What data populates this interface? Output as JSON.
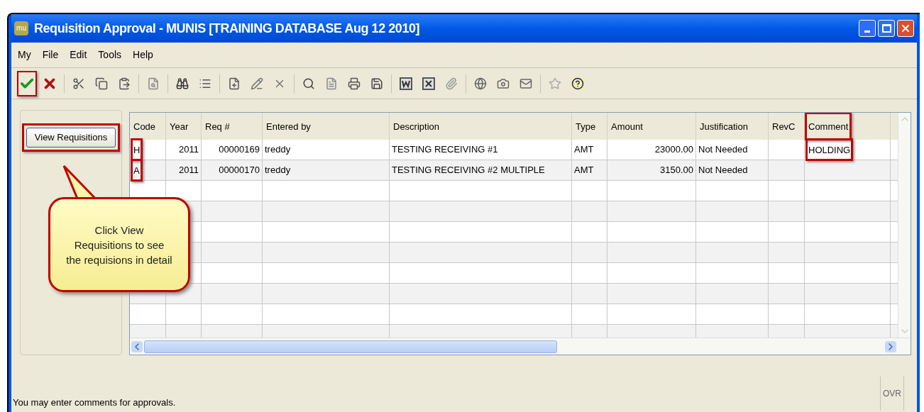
{
  "window": {
    "title": "Requisition Approval - MUNIS [TRAINING DATABASE Aug 12 2010]",
    "app_icon": "mu"
  },
  "menu": [
    "My",
    "File",
    "Edit",
    "Tools",
    "Help"
  ],
  "toolbar": [
    {
      "buttons": [
        {
          "kind": "approve",
          "highlighted": true
        },
        {
          "kind": "reject",
          "highlighted": false
        }
      ]
    },
    {
      "buttons": [
        {
          "kind": "cut",
          "highlighted": false
        },
        {
          "kind": "copy",
          "highlighted": false
        },
        {
          "kind": "paste",
          "highlighted": false
        }
      ]
    },
    {
      "buttons": [
        {
          "kind": "browse",
          "highlighted": false
        }
      ]
    },
    {
      "buttons": [
        {
          "kind": "find",
          "highlighted": false
        },
        {
          "kind": "list",
          "highlighted": false
        }
      ]
    },
    {
      "buttons": [
        {
          "kind": "add",
          "highlighted": false
        },
        {
          "kind": "edit",
          "highlighted": false
        },
        {
          "kind": "delete",
          "highlighted": false
        }
      ]
    },
    {
      "buttons": [
        {
          "kind": "preview",
          "highlighted": false
        },
        {
          "kind": "document",
          "highlighted": false
        },
        {
          "kind": "print",
          "highlighted": false
        },
        {
          "kind": "save",
          "highlighted": false
        }
      ]
    },
    {
      "buttons": [
        {
          "kind": "word",
          "highlighted": false
        },
        {
          "kind": "excel",
          "highlighted": false
        },
        {
          "kind": "attach",
          "highlighted": false
        }
      ]
    },
    {
      "buttons": [
        {
          "kind": "globe",
          "highlighted": false
        },
        {
          "kind": "camera",
          "highlighted": false
        },
        {
          "kind": "mail",
          "highlighted": false
        }
      ]
    },
    {
      "buttons": [
        {
          "kind": "favorite",
          "highlighted": false
        },
        {
          "kind": "help",
          "highlighted": false
        }
      ]
    }
  ],
  "side_button": {
    "label": "View Requisitions",
    "highlighted": true
  },
  "callout": {
    "text": "Click View Requisitions to see the requisions in detail"
  },
  "table": {
    "columns": [
      {
        "label": "Code",
        "highlighted": false
      },
      {
        "label": "Year",
        "highlighted": false
      },
      {
        "label": "Req #",
        "highlighted": false
      },
      {
        "label": "Entered by",
        "highlighted": false
      },
      {
        "label": "Description",
        "highlighted": false
      },
      {
        "label": "Type",
        "highlighted": false
      },
      {
        "label": "Amount",
        "highlighted": false
      },
      {
        "label": "Justification",
        "highlighted": false
      },
      {
        "label": "RevC",
        "highlighted": false
      },
      {
        "label": "Comment",
        "highlighted": true
      }
    ],
    "rows": [
      {
        "code": {
          "text": "H",
          "highlighted": true
        },
        "year": "2011",
        "req": "00000169",
        "entered_by": "treddy",
        "description": "TESTING RECEIVING #1",
        "type": "AMT",
        "amount": "23000.00",
        "justification": "Not Needed",
        "comment": {
          "text": "HOLDING",
          "highlighted": true
        }
      },
      {
        "code": {
          "text": "A",
          "highlighted": true
        },
        "year": "2011",
        "req": "00000170",
        "entered_by": "treddy",
        "description": "TESTING RECEIVING #2 MULTIPLE",
        "type": "AMT",
        "amount": "3150.00",
        "justification": "Not Needed"
      }
    ]
  },
  "status_bar": {
    "message": "You may enter comments for approvals.",
    "mode": "OVR"
  }
}
